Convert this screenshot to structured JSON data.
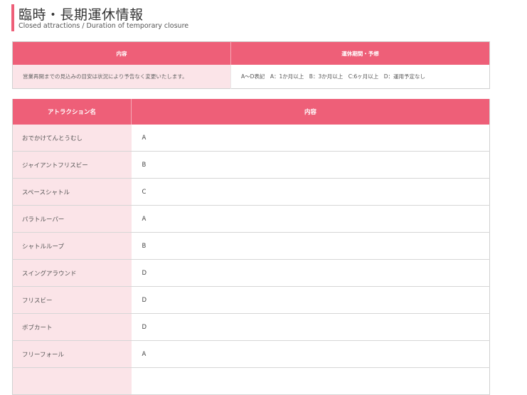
{
  "header": {
    "title": "臨時・長期運休情報",
    "subtitle": "Closed attractions / Duration of temporary closure"
  },
  "info_table": {
    "headers": [
      "内容",
      "運休期間・予想"
    ],
    "note": "営業再開までの見込みの目安は状況により予告なく変更いたします。",
    "legend": "A〜D表記　A：1か月以上　B：3か月以上　C:6ヶ月以上　D：運用予定なし"
  },
  "attraction_table": {
    "headers": [
      "アトラクション名",
      "内容"
    ],
    "rows": [
      {
        "name": "おでかけてんとうむし",
        "status": "A"
      },
      {
        "name": "ジャイアントフリスビー",
        "status": "B"
      },
      {
        "name": "スペースシャトル",
        "status": "C"
      },
      {
        "name": "パラトルーパー",
        "status": "A"
      },
      {
        "name": "シャトルループ",
        "status": "B"
      },
      {
        "name": "スイングアラウンド",
        "status": "D"
      },
      {
        "name": "フリスビー",
        "status": "D"
      },
      {
        "name": "ボブカート",
        "status": "D"
      },
      {
        "name": "フリーフォール",
        "status": "A"
      },
      {
        "name": "",
        "status": ""
      }
    ]
  }
}
